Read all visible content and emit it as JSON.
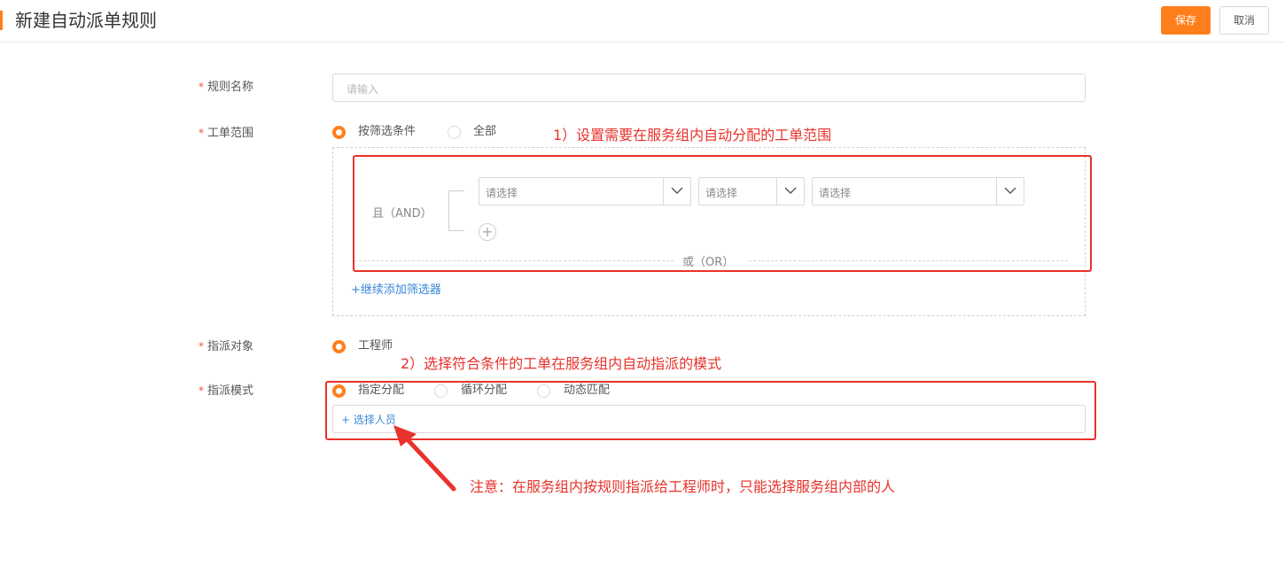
{
  "header": {
    "title": "新建自动派单规则",
    "save_label": "保存",
    "cancel_label": "取消"
  },
  "form": {
    "required_mark": "*",
    "rule_name": {
      "label": "规则名称",
      "placeholder": "请输入",
      "value": ""
    },
    "scope": {
      "label": "工单范围",
      "options": [
        {
          "label": "按筛选条件",
          "selected": true
        },
        {
          "label": "全部",
          "selected": false
        }
      ],
      "and_label": "且（AND）",
      "selects": [
        "请选择",
        "请选择",
        "请选择"
      ],
      "add_condition_icon": "plus-circle-icon",
      "or_label": "或（OR）",
      "add_filter_label": "+继续添加筛选器"
    },
    "target": {
      "label": "指派对象",
      "options": [
        {
          "label": "工程师",
          "selected": true
        }
      ]
    },
    "mode": {
      "label": "指派模式",
      "options": [
        {
          "label": "指定分配",
          "selected": true
        },
        {
          "label": "循环分配",
          "selected": false
        },
        {
          "label": "动态匹配",
          "selected": false
        }
      ],
      "select_person_label": "+ 选择人员"
    }
  },
  "annotations": {
    "note1": "1）设置需要在服务组内自动分配的工单范围",
    "note2": "2）选择符合条件的工单在服务组内自动指派的模式",
    "note3": "注意：在服务组内按规则指派给工程师时，只能选择服务组内部的人"
  },
  "colors": {
    "accent": "#ff7e1c",
    "annotation": "#e8322b",
    "link": "#3a87d9"
  }
}
